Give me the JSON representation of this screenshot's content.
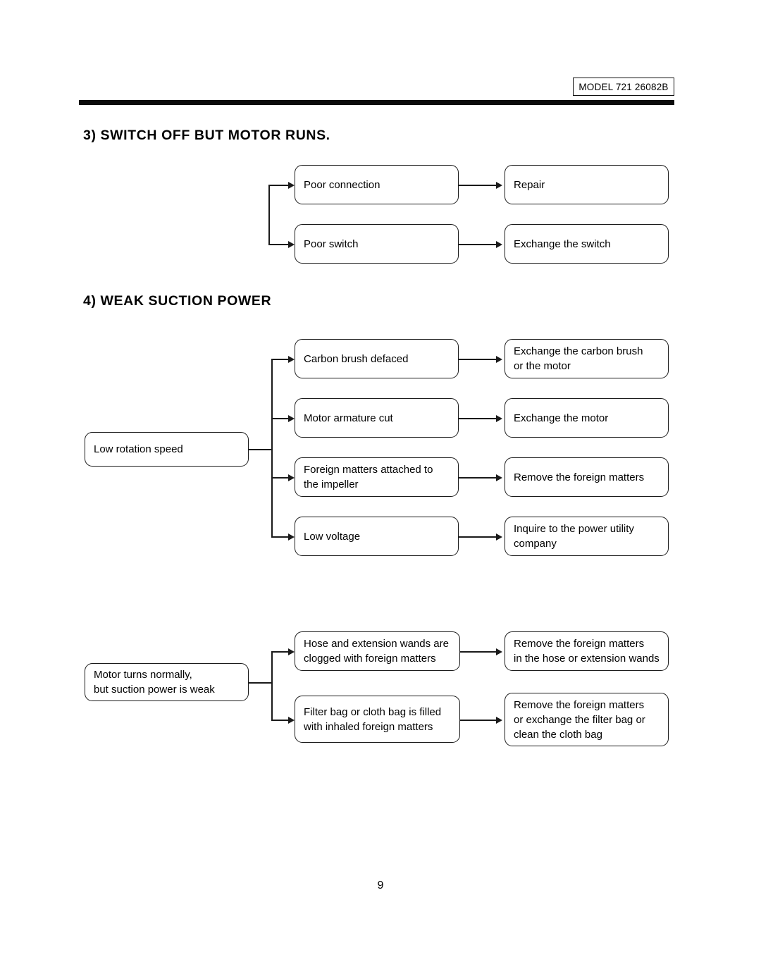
{
  "document": {
    "model_badge": "MODEL 721 26082B",
    "page_number": "9"
  },
  "sections": [
    {
      "heading": "3) SWITCH OFF BUT MOTOR RUNS.",
      "causes": [
        {
          "cause": "Poor connection",
          "remedy": "Repair"
        },
        {
          "cause": "Poor switch",
          "remedy": "Exchange the switch"
        }
      ]
    },
    {
      "heading": "4) WEAK SUCTION POWER",
      "groups": [
        {
          "symptom": "Low rotation speed",
          "causes": [
            {
              "cause": "Carbon brush defaced",
              "remedy": "Exchange the carbon brush\nor the motor"
            },
            {
              "cause": "Motor armature cut",
              "remedy": "Exchange the motor"
            },
            {
              "cause": "Foreign matters attached to\nthe impeller",
              "remedy": "Remove the foreign matters"
            },
            {
              "cause": "Low voltage",
              "remedy": "Inquire to the power utility\ncompany"
            }
          ]
        },
        {
          "symptom": "Motor turns normally,\nbut suction power is weak",
          "causes": [
            {
              "cause": "Hose and extension wands are\nclogged with foreign matters",
              "remedy": "Remove the foreign matters\nin the hose or extension wands"
            },
            {
              "cause": "Filter bag or cloth bag is filled\nwith inhaled foreign matters",
              "remedy": "Remove the foreign matters\nor exchange the filter bag or\nclean the cloth bag"
            }
          ]
        }
      ]
    }
  ]
}
